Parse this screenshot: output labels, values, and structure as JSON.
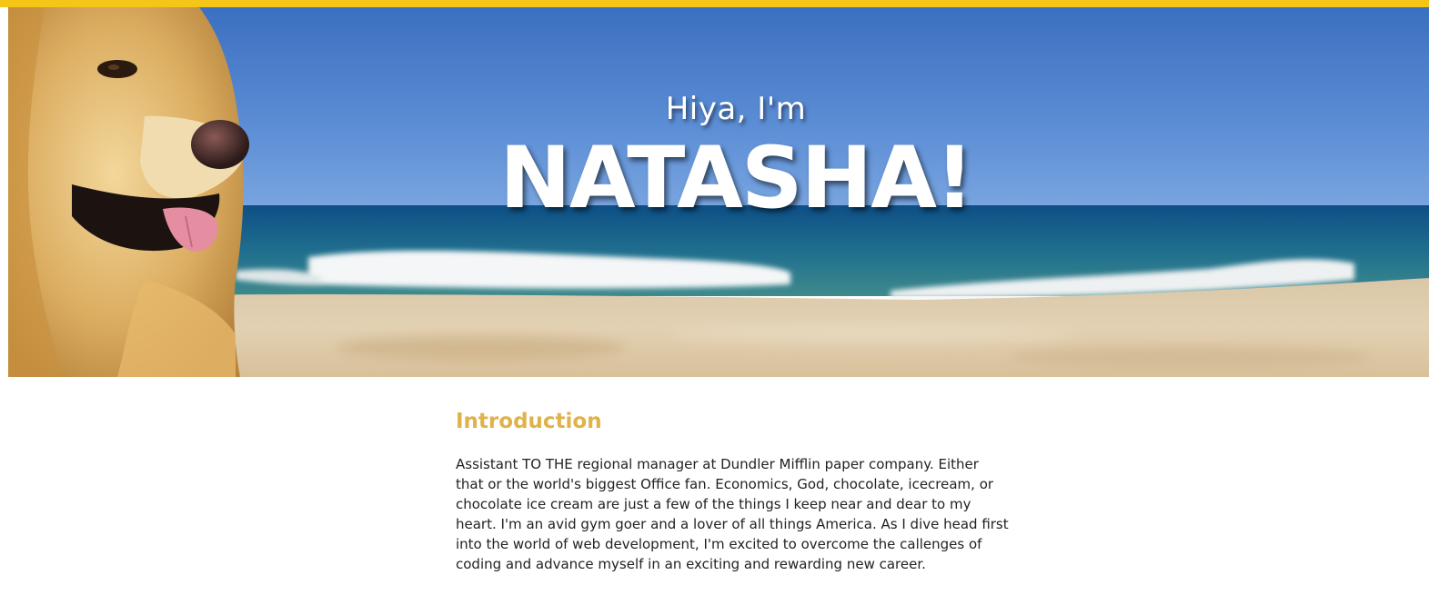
{
  "hero": {
    "subtitle": "Hiya, I'm",
    "title": "NATASHA!"
  },
  "intro": {
    "heading": "Introduction",
    "body": "Assistant TO THE regional manager at Dundler Mifflin paper company. Either that or the world's biggest Office fan. Economics, God, chocolate, icecream, or chocolate ice cream are just a few of the things I keep near and dear to my heart. I'm an avid gym goer and a lover of all things America. As I dive head first into the world of web development, I'm excited to overcome the callenges of coding and advance myself in an exciting and rewarding new career."
  },
  "colors": {
    "accent_bar": "#f5c518",
    "heading": "#e0b24a",
    "text": "#222222"
  }
}
